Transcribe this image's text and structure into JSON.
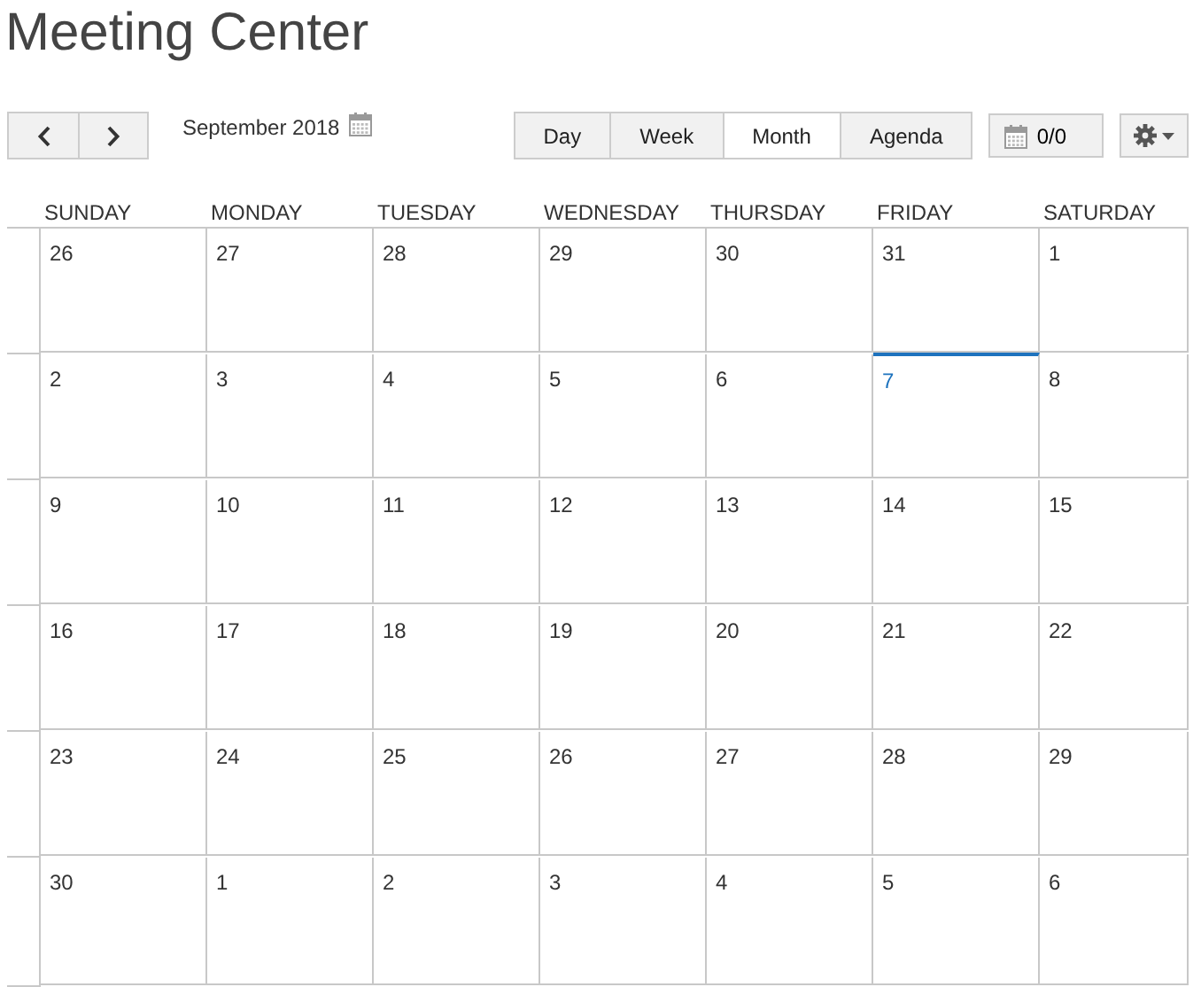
{
  "title": "Meeting Center",
  "toolbar": {
    "period": "September 2018",
    "views": [
      {
        "label": "Day",
        "selected": false
      },
      {
        "label": "Week",
        "selected": false
      },
      {
        "label": "Month",
        "selected": true
      },
      {
        "label": "Agenda",
        "selected": false
      }
    ],
    "counter": "0/0"
  },
  "weekdays": [
    "SUNDAY",
    "MONDAY",
    "TUESDAY",
    "WEDNESDAY",
    "THURSDAY",
    "FRIDAY",
    "SATURDAY"
  ],
  "weeks": [
    [
      {
        "day": "26",
        "today": false
      },
      {
        "day": "27",
        "today": false
      },
      {
        "day": "28",
        "today": false
      },
      {
        "day": "29",
        "today": false
      },
      {
        "day": "30",
        "today": false
      },
      {
        "day": "31",
        "today": false
      },
      {
        "day": "1",
        "today": false
      }
    ],
    [
      {
        "day": "2",
        "today": false
      },
      {
        "day": "3",
        "today": false
      },
      {
        "day": "4",
        "today": false
      },
      {
        "day": "5",
        "today": false
      },
      {
        "day": "6",
        "today": false
      },
      {
        "day": "7",
        "today": true
      },
      {
        "day": "8",
        "today": false
      }
    ],
    [
      {
        "day": "9",
        "today": false
      },
      {
        "day": "10",
        "today": false
      },
      {
        "day": "11",
        "today": false
      },
      {
        "day": "12",
        "today": false
      },
      {
        "day": "13",
        "today": false
      },
      {
        "day": "14",
        "today": false
      },
      {
        "day": "15",
        "today": false
      }
    ],
    [
      {
        "day": "16",
        "today": false
      },
      {
        "day": "17",
        "today": false
      },
      {
        "day": "18",
        "today": false
      },
      {
        "day": "19",
        "today": false
      },
      {
        "day": "20",
        "today": false
      },
      {
        "day": "21",
        "today": false
      },
      {
        "day": "22",
        "today": false
      }
    ],
    [
      {
        "day": "23",
        "today": false
      },
      {
        "day": "24",
        "today": false
      },
      {
        "day": "25",
        "today": false
      },
      {
        "day": "26",
        "today": false
      },
      {
        "day": "27",
        "today": false
      },
      {
        "day": "28",
        "today": false
      },
      {
        "day": "29",
        "today": false
      }
    ],
    [
      {
        "day": "30",
        "today": false
      },
      {
        "day": "1",
        "today": false
      },
      {
        "day": "2",
        "today": false
      },
      {
        "day": "3",
        "today": false
      },
      {
        "day": "4",
        "today": false
      },
      {
        "day": "5",
        "today": false
      },
      {
        "day": "6",
        "today": false
      }
    ]
  ]
}
